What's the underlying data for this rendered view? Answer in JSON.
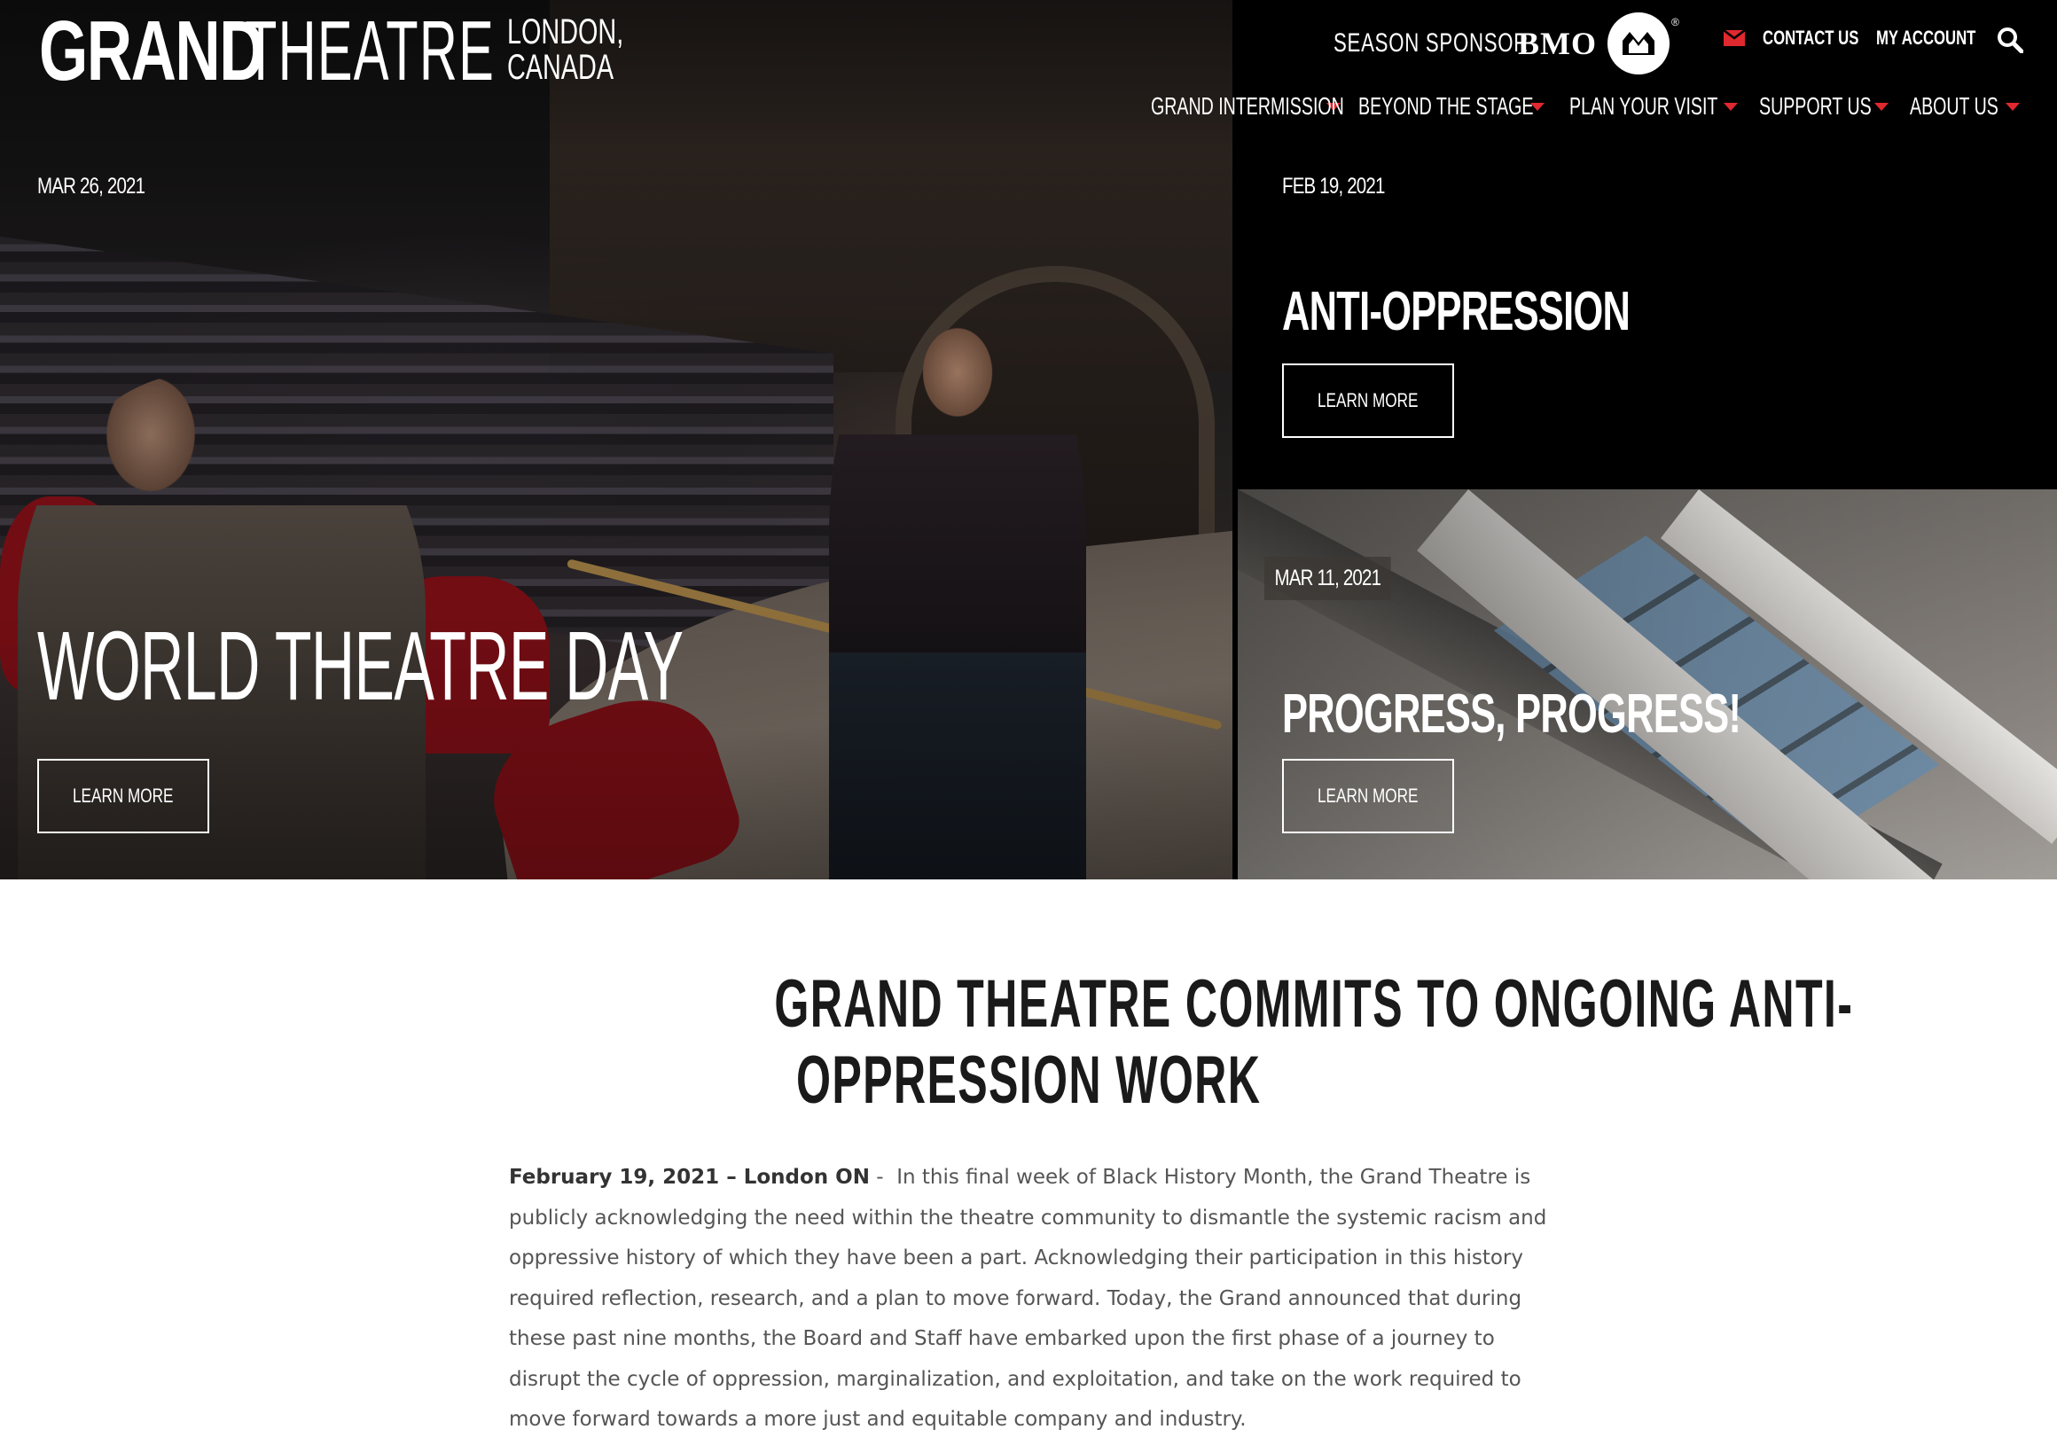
{
  "header": {
    "logo": {
      "grand": "GRAND",
      "theatre": "THEATRE",
      "city": "LONDON,",
      "country": "CANADA"
    },
    "sponsor": {
      "label": "SEASON SPONSOR",
      "brand": "BMO",
      "reg": "®"
    },
    "utility": {
      "contact": "CONTACT US",
      "account": "MY ACCOUNT"
    },
    "icons": {
      "mail": "mail-icon",
      "search": "search-icon",
      "roundel": "bmo-roundel-icon"
    },
    "accent_color": "#e0282f",
    "nav": [
      {
        "label": "GRAND INTERMISSION"
      },
      {
        "label": "BEYOND THE STAGE"
      },
      {
        "label": "PLAN YOUR VISIT"
      },
      {
        "label": "SUPPORT US"
      },
      {
        "label": "ABOUT US"
      }
    ]
  },
  "tiles": {
    "left": {
      "date": "MAR 26, 2021",
      "title": "WORLD THEATRE DAY",
      "button": "LEARN MORE"
    },
    "right_top": {
      "date": "FEB 19, 2021",
      "title": "ANTI-OPPRESSION",
      "button": "LEARN MORE"
    },
    "right_bottom": {
      "date": "MAR 11, 2021",
      "title": "PROGRESS, PROGRESS!",
      "button": "LEARN MORE"
    }
  },
  "article": {
    "title_line1": "GRAND THEATRE COMMITS TO ONGOING ANTI-",
    "title_line2": "OPPRESSION WORK",
    "dateline": "February 19, 2021 – London ON",
    "separator": " -  ",
    "body": "In this final week of Black History Month, the Grand Theatre is publicly acknowledging the need within the theatre community to dismantle the systemic racism and oppressive history of which they have been a part. Acknowledging their participation in this history required reflection, research, and a plan to move forward. Today, the Grand announced that during these past nine months, the Board and Staff have embarked upon the first phase of a journey to disrupt the cycle of oppression, marginalization, and exploitation, and take on the work required to move forward towards a more just and equitable company and industry."
  }
}
